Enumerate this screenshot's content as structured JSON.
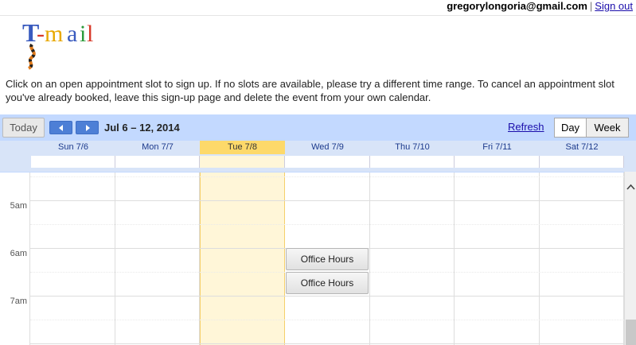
{
  "header": {
    "user_email": "gregorylongoria@gmail.com",
    "separator": "|",
    "sign_out": "Sign out"
  },
  "logo": {
    "text": "T-mail",
    "colors": [
      "#3a5bbf",
      "#d83a2a",
      "#e8a800",
      "#3a5bbf",
      "#2a9a3a",
      "#d83a2a"
    ]
  },
  "instructions": "Click on an open appointment slot to sign up. If no slots are available, please try a different time range. To cancel an appointment slot you've already booked, leave this sign-up page and delete the event from your own calendar.",
  "toolbar": {
    "today": "Today",
    "prev_icon": "left-arrow-icon",
    "next_icon": "right-arrow-icon",
    "date_range": "Jul 6 – 12, 2014",
    "refresh": "Refresh",
    "views": [
      "Day",
      "Week"
    ],
    "active_view": "Week"
  },
  "days": [
    {
      "label": "Sun 7/6"
    },
    {
      "label": "Mon 7/7"
    },
    {
      "label": "Tue 7/8",
      "today": true
    },
    {
      "label": "Wed 7/9"
    },
    {
      "label": "Thu 7/10"
    },
    {
      "label": "Fri 7/11"
    },
    {
      "label": "Sat 7/12"
    }
  ],
  "hours": [
    "5am",
    "6am",
    "7am"
  ],
  "slots": [
    {
      "day": "Wed 7/9",
      "title": "Office Hours"
    },
    {
      "day": "Wed 7/9",
      "title": "Office Hours"
    }
  ],
  "colors": {
    "toolbar_bg": "#c3d9ff",
    "today_header": "#fdd96a",
    "today_column": "#fff6d8",
    "link": "#1a0dab"
  }
}
